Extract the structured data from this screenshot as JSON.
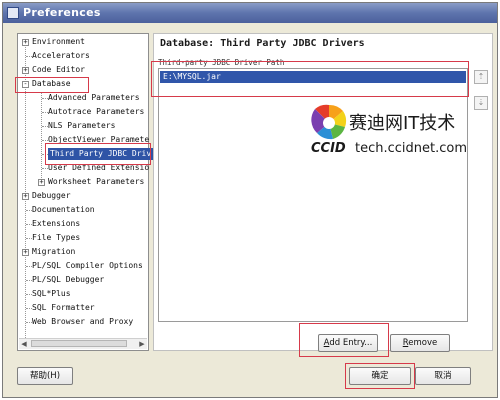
{
  "window": {
    "title": "Preferences"
  },
  "tree": {
    "items": [
      {
        "label": "Environment",
        "expander": "+"
      },
      {
        "label": "Accelerators",
        "expander": ""
      },
      {
        "label": "Code Editor",
        "expander": "+"
      },
      {
        "label": "Database",
        "expander": "-"
      },
      {
        "label": "Advanced Parameters",
        "expander": ""
      },
      {
        "label": "Autotrace Parameters",
        "expander": ""
      },
      {
        "label": "NLS Parameters",
        "expander": ""
      },
      {
        "label": "ObjectViewer Paramete",
        "expander": ""
      },
      {
        "label": "Third Party JDBC Driv",
        "expander": ""
      },
      {
        "label": "User Defined Extensio",
        "expander": ""
      },
      {
        "label": "Worksheet Parameters",
        "expander": "+"
      },
      {
        "label": "Debugger",
        "expander": "+"
      },
      {
        "label": "Documentation",
        "expander": ""
      },
      {
        "label": "Extensions",
        "expander": ""
      },
      {
        "label": "File Types",
        "expander": ""
      },
      {
        "label": "Migration",
        "expander": "+"
      },
      {
        "label": "PL/SQL Compiler Options",
        "expander": ""
      },
      {
        "label": "PL/SQL Debugger",
        "expander": ""
      },
      {
        "label": "SQL*Plus",
        "expander": ""
      },
      {
        "label": "SQL Formatter",
        "expander": ""
      },
      {
        "label": "Web Browser and Proxy",
        "expander": ""
      }
    ]
  },
  "content": {
    "title": "Database: Third Party JDBC Drivers",
    "section_label": "Third-party JDBC Driver Path",
    "paths": [
      "E:\\MYSQL.jar"
    ]
  },
  "buttons": {
    "add_entry": "Add Entry...",
    "remove": "Remove",
    "help": "帮助(H)",
    "ok": "确定",
    "cancel": "取消"
  },
  "watermark": {
    "chinese": "赛迪网IT技术",
    "brand": "CCID",
    "url": "tech.ccidnet.com"
  },
  "colors": {
    "selection": "#2f54a6",
    "highlight": "#d63a4a",
    "titlebar": "#5e74ad"
  }
}
